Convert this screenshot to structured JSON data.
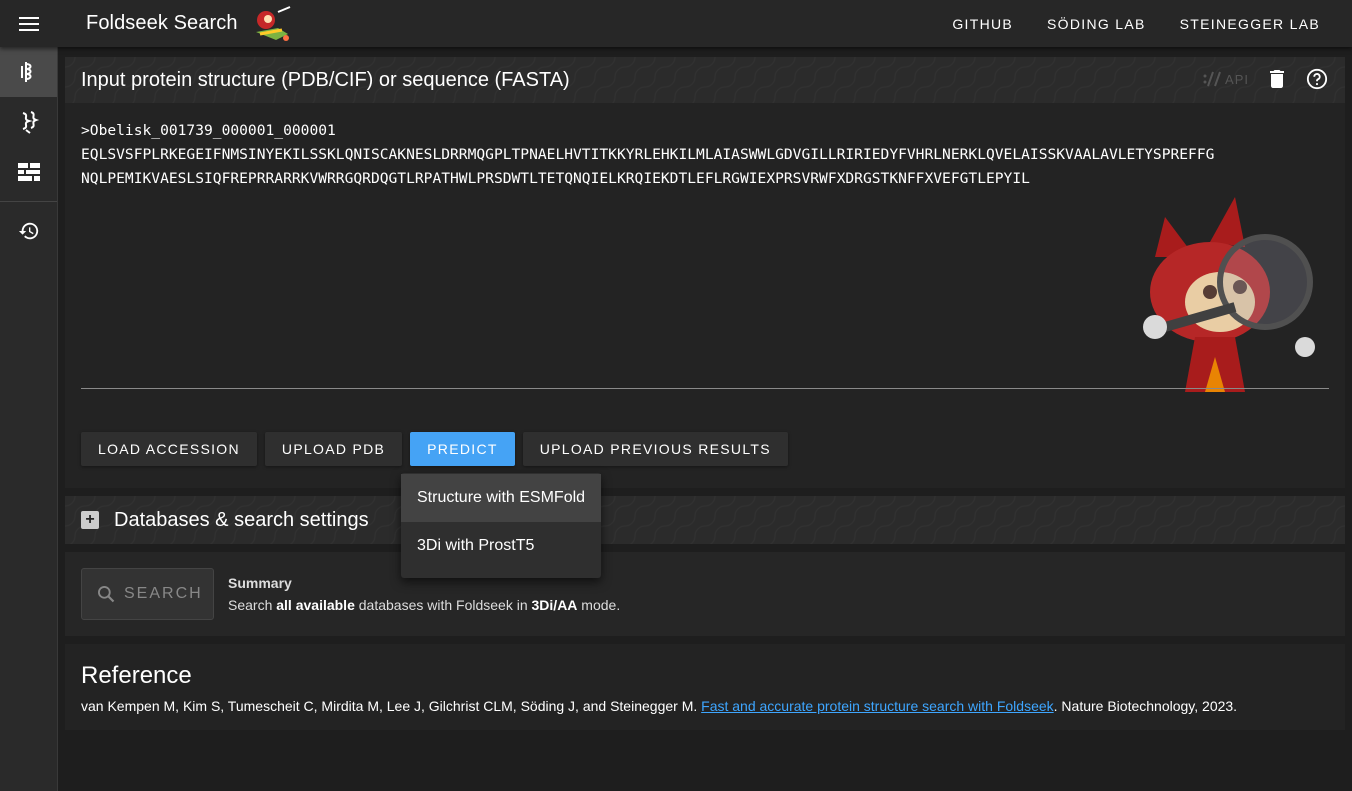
{
  "topbar": {
    "title": "Foldseek Search",
    "links": [
      "GITHUB",
      "SÖDING LAB",
      "STEINEGGER LAB"
    ]
  },
  "input_card": {
    "title": "Input protein structure (PDB/CIF) or sequence (FASTA)",
    "api_label": "API",
    "sequence_text": ">Obelisk_001739_000001_000001\nEQLSVSFPLRKEGEIFNMSINYEKILSSKLQNISCAKNESLDRRMQGPLTPNAELHVTITKKYRLEHKILMLAIASWWLGDVGILLRIRIEDYFVHRLNERKLQVELAISSKVAALAVLETYSPREFFG\nNQLPEMIKVAESLSIQFREPRRARRKVWRRGQRDQGTLRPATHWLPRSDWTLTETQNQIELKRQIEKDTLEFLRGWIEXPRSVRWFXDRGSTKNFFXVEFGTLEPYIL",
    "buttons": {
      "load_accession": "LOAD ACCESSION",
      "upload_pdb": "UPLOAD PDB",
      "predict": "PREDICT",
      "upload_previous": "UPLOAD PREVIOUS RESULTS"
    }
  },
  "predict_menu": {
    "items": [
      "Structure with ESMFold",
      "3Di with ProstT5"
    ]
  },
  "databases_card": {
    "title": "Databases & search settings"
  },
  "search_card": {
    "search_label": "SEARCH",
    "summary_title": "Summary",
    "summary_pre": "Search ",
    "summary_bold1": "all available",
    "summary_mid": " databases with Foldseek in ",
    "summary_bold2": "3Di/AA",
    "summary_post": " mode."
  },
  "reference": {
    "title": "Reference",
    "authors": "van Kempen M, Kim S, Tumescheit C, Mirdita M, Lee J, Gilchrist CLM, Söding J, and Steinegger M. ",
    "link_text": "Fast and accurate protein structure search with Foldseek",
    "journal": ". Nature Biotechnology, 2023."
  },
  "colors": {
    "accent": "#45a3f5",
    "link": "#3ea6ff",
    "background": "#1e1e1e"
  },
  "icons": [
    "menu-icon",
    "foldseek-logo",
    "structure-search-icon",
    "multimer-search-icon",
    "database-icon",
    "history-icon",
    "api-icon",
    "trash-icon",
    "help-icon",
    "plus-icon",
    "search-icon"
  ]
}
